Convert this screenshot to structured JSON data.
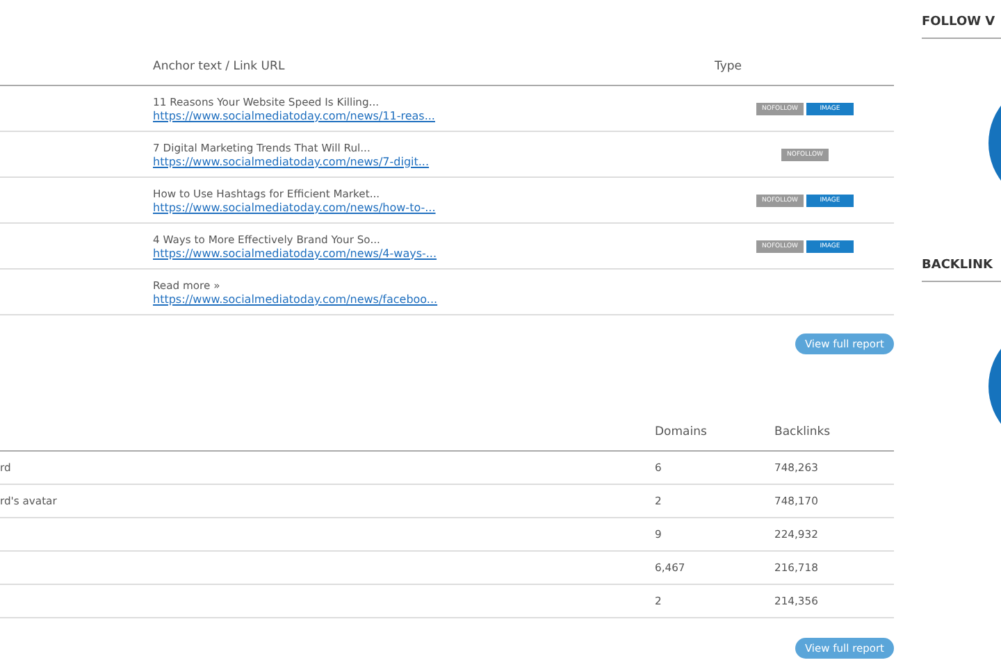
{
  "links_table": {
    "columns": [
      "Anchor text / Link URL",
      "Type"
    ],
    "rows": [
      {
        "anchor": "11 Reasons Your Website Speed Is Killing...",
        "url": "https://www.socialmediatoday.com/news/11-reas...",
        "tags": [
          {
            "kind": "nofollow",
            "label": "NOFOLLOW"
          },
          {
            "kind": "image",
            "label": "IMAGE"
          }
        ]
      },
      {
        "anchor": "7 Digital Marketing Trends That Will Rul...",
        "url": "https://www.socialmediatoday.com/news/7-digit...",
        "tags": [
          {
            "kind": "nofollow",
            "label": "NOFOLLOW"
          }
        ]
      },
      {
        "anchor": "How to Use Hashtags for Efficient Market...",
        "url": "https://www.socialmediatoday.com/news/how-to-...",
        "tags": [
          {
            "kind": "nofollow",
            "label": "NOFOLLOW"
          },
          {
            "kind": "image",
            "label": "IMAGE"
          }
        ]
      },
      {
        "anchor": "4 Ways to More Effectively Brand Your So...",
        "url": "https://www.socialmediatoday.com/news/4-ways-...",
        "tags": [
          {
            "kind": "nofollow",
            "label": "NOFOLLOW"
          },
          {
            "kind": "image",
            "label": "IMAGE"
          }
        ]
      },
      {
        "anchor": "Read more »",
        "url": "https://www.socialmediatoday.com/news/faceboo...",
        "tags": []
      }
    ],
    "button": "View full report"
  },
  "anchors_table": {
    "columns": [
      "Domains",
      "Backlinks"
    ],
    "rows": [
      {
        "anchor": "rd",
        "domains": "6",
        "backlinks": "748,263"
      },
      {
        "anchor": "rd's avatar",
        "domains": "2",
        "backlinks": "748,170"
      },
      {
        "anchor": "",
        "domains": "9",
        "backlinks": "224,932"
      },
      {
        "anchor": "",
        "domains": "6,467",
        "backlinks": "216,718"
      },
      {
        "anchor": "",
        "domains": "2",
        "backlinks": "214,356"
      }
    ],
    "button": "View full report"
  },
  "sidebar": {
    "sections": [
      {
        "title": "FOLLOW V"
      },
      {
        "title": "BACKLINK"
      }
    ]
  }
}
